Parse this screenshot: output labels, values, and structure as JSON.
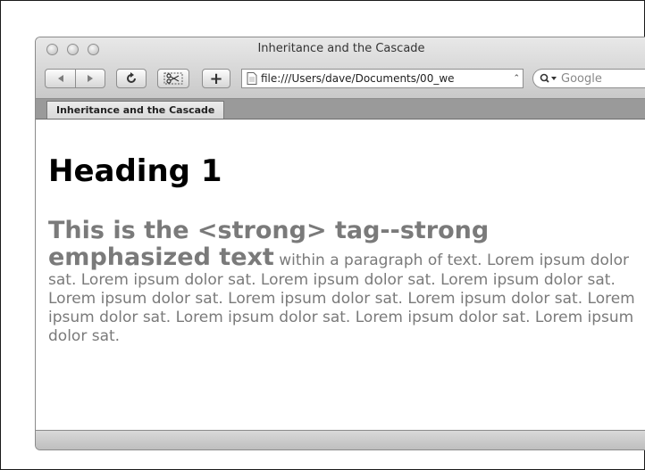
{
  "window": {
    "title": "Inheritance and the Cascade"
  },
  "toolbar": {
    "back_icon": "back-arrow-icon",
    "forward_icon": "forward-arrow-icon",
    "reload_icon": "reload-icon",
    "snippet_icon": "scissors-icon",
    "add_bookmark_label": "+",
    "url": "file:///Users/dave/Documents/00_we",
    "search_placeholder": "Google"
  },
  "tabs": [
    {
      "label": "Inheritance and the Cascade"
    }
  ],
  "page": {
    "heading": "Heading 1",
    "strong_text": "This is the <strong> tag--strong emphasized text",
    "paragraph_text": " within a paragraph of text. Lorem ipsum dolor sat. Lorem ipsum dolor sat. Lorem ipsum dolor sat. Lorem ipsum dolor sat. Lorem ipsum dolor sat. Lorem ipsum dolor sat. Lorem ipsum dolor sat. Lorem ipsum dolor sat. Lorem ipsum dolor sat. Lorem ipsum dolor sat. Lorem ipsum dolor sat."
  },
  "colors": {
    "paragraph_text": "#7a7a7a",
    "heading_text": "#000000",
    "tabbar": "#9a9a9a"
  }
}
